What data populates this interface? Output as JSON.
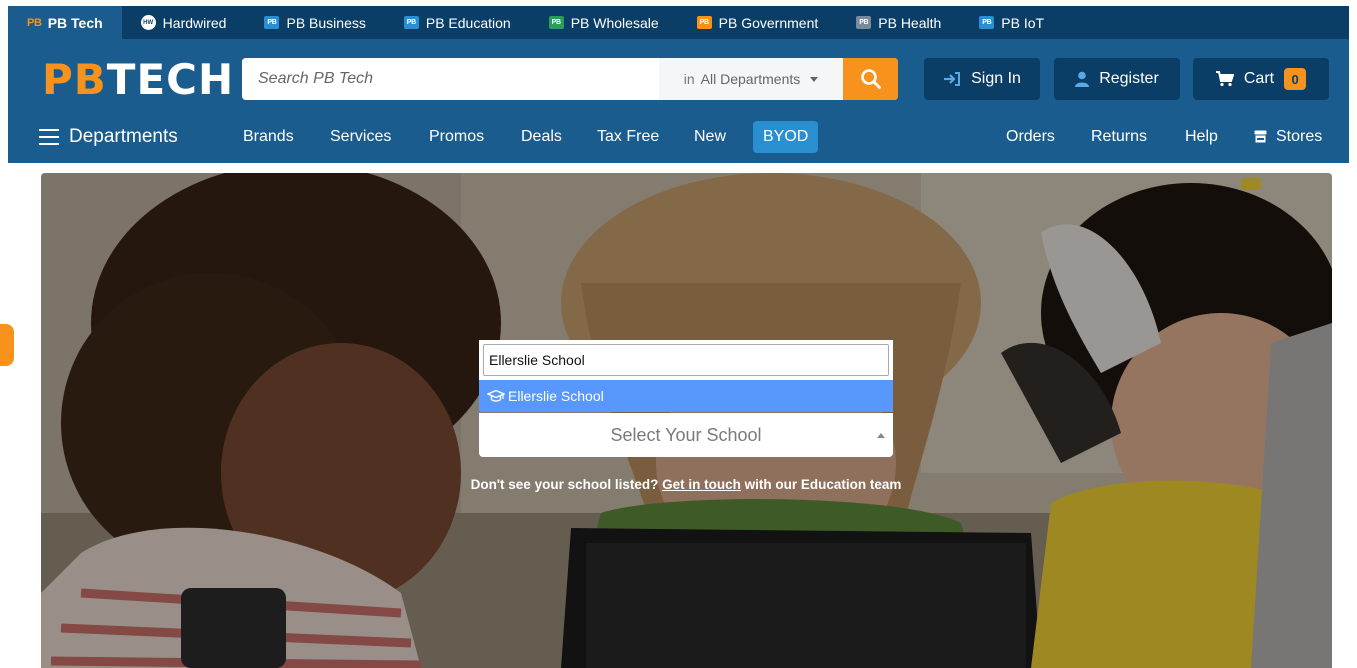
{
  "sitebar": {
    "tabs": [
      {
        "label": "PB Tech",
        "badge": "PB",
        "badge_color": "#f7931d",
        "active": true
      },
      {
        "label": "Hardwired",
        "badge": "HW",
        "badge_color": "#ffffff",
        "active": false
      },
      {
        "label": "PB Business",
        "badge": "PB",
        "badge_color": "#2a8fd0",
        "active": false
      },
      {
        "label": "PB Education",
        "badge": "PB",
        "badge_color": "#2a8fd0",
        "active": false
      },
      {
        "label": "PB Wholesale",
        "badge": "PB",
        "badge_color": "#2a9d5c",
        "active": false
      },
      {
        "label": "PB Government",
        "badge": "PB",
        "badge_color": "#f7931d",
        "active": false
      },
      {
        "label": "PB Health",
        "badge": "PB",
        "badge_color": "#7a8a9a",
        "active": false
      },
      {
        "label": "PB IoT",
        "badge": "PB",
        "badge_color": "#2a8fd0",
        "active": false
      }
    ]
  },
  "header": {
    "logo_pb": "PB",
    "logo_tech": "TECH",
    "search_placeholder": "Search PB Tech",
    "dept_in": "in",
    "dept_selected": "All Departments",
    "sign_in": "Sign In",
    "register": "Register",
    "cart": "Cart",
    "cart_count": "0"
  },
  "nav": {
    "departments": "Departments",
    "left_items": [
      "Brands",
      "Services",
      "Promos",
      "Deals",
      "Tax Free",
      "New",
      "BYOD"
    ],
    "right_items": [
      "Orders",
      "Returns",
      "Help",
      "Stores"
    ]
  },
  "school_picker": {
    "search_value": "Ellerslie School",
    "option": "Ellerslie School",
    "select_placeholder": "Select Your School"
  },
  "help": {
    "before": "Don't see your school listed?",
    "link": "Get in touch",
    "after": "with our Education team"
  },
  "colors": {
    "brand_dark": "#0b3e66",
    "brand": "#1b5c8e",
    "accent": "#f7931d",
    "byod": "#2a8fd0",
    "option_highlight": "#5897fb"
  }
}
